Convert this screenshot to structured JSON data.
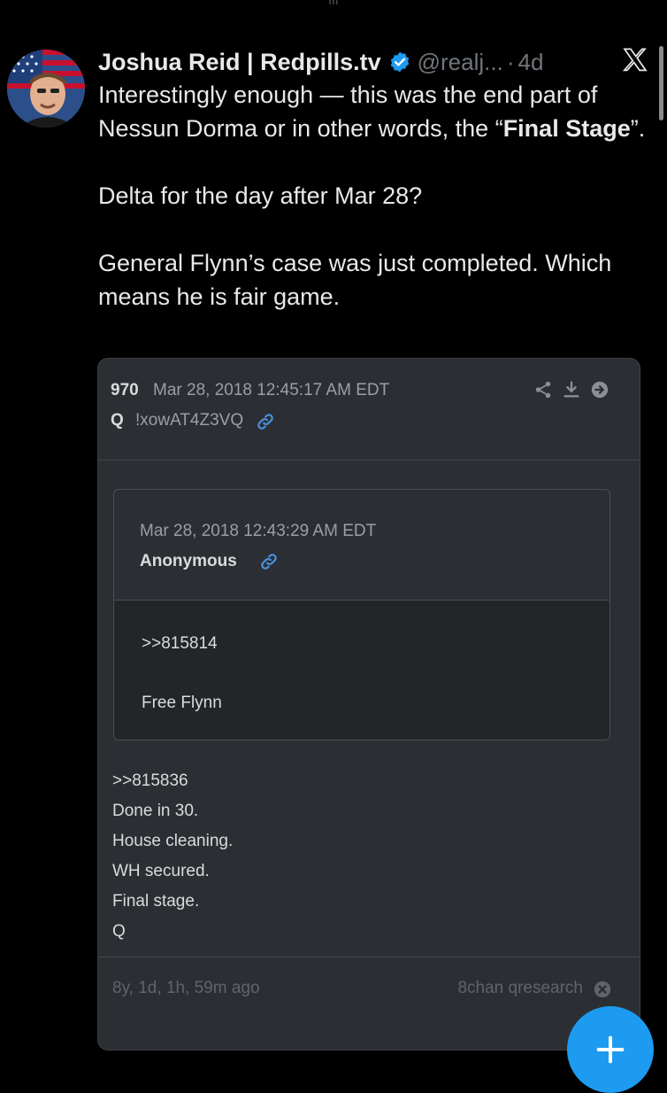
{
  "tweet": {
    "author_name": "Joshua Reid | Redpills.tv",
    "handle": "@realj...",
    "separator": "·",
    "time": "4d",
    "lines": [
      {
        "text_before": "Interestingly enough — this was the end part of Nessun Dorma or in other words, the “",
        "bold": "Final Stage",
        "text_after": "”."
      },
      {
        "text_before": "Delta for the day after Mar 28?"
      },
      {
        "text_before": "General Flynn’s case was just completed. Which means he is fair game."
      }
    ]
  },
  "quote": {
    "post_number": "970",
    "post_date": "Mar 28, 2018 12:45:17 AM EDT",
    "author": "Q",
    "tripcode": "!xowAT4Z3VQ",
    "replied": {
      "date": "Mar 28, 2018 12:43:29 AM EDT",
      "author": "Anonymous",
      "ref": ">>815814",
      "text": "Free Flynn"
    },
    "body": [
      ">>815836",
      "Done in 30.",
      "House cleaning.",
      "WH secured.",
      "Final stage.",
      "Q"
    ],
    "age": "8y, 1d, 1h, 59m ago",
    "source": "8chan qresearch"
  },
  "colors": {
    "accent": "#1d9bf0",
    "background": "#000000",
    "card": "#2b2f33"
  }
}
